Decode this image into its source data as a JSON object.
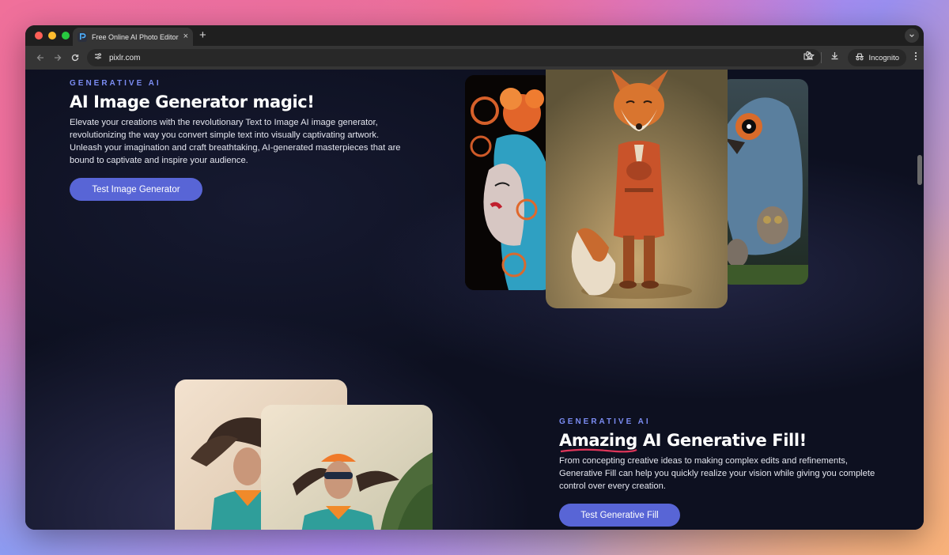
{
  "browser": {
    "tab_title": "Free Online AI Photo Editor, I",
    "url": "pixlr.com",
    "incognito_label": "Incognito",
    "new_tab_symbol": "+",
    "close_symbol": "×"
  },
  "section_image_generator": {
    "eyebrow": "GENERATIVE AI",
    "title": "AI Image Generator magic!",
    "description": "Elevate your creations with the revolutionary Text to Image AI image generator, revolutionizing the way you convert simple text into visually captivating artwork. Unleash your imagination and craft breathtaking, AI-generated masterpieces that are bound to captivate and inspire your audience.",
    "button_label": "Test Image Generator"
  },
  "section_generative_fill": {
    "eyebrow": "GENERATIVE AI",
    "title_highlight": "Amazing",
    "title_rest": " AI Generative Fill!",
    "description": "From concepting creative ideas to making complex edits and refinements, Generative Fill can help you quickly realize your vision while giving you complete control over every creation.",
    "button_label": "Test Generative Fill"
  },
  "colors": {
    "accent": "#5865d6",
    "eyebrow": "#7b8cf2",
    "underline": "#e0365a",
    "page_bg": "#0d1020"
  },
  "icons": [
    "back-arrow-icon",
    "forward-arrow-icon",
    "reload-icon",
    "site-info-icon",
    "bookmark-star-icon",
    "extensions-icon",
    "download-icon",
    "incognito-icon",
    "more-menu-icon",
    "chevron-down-icon"
  ]
}
